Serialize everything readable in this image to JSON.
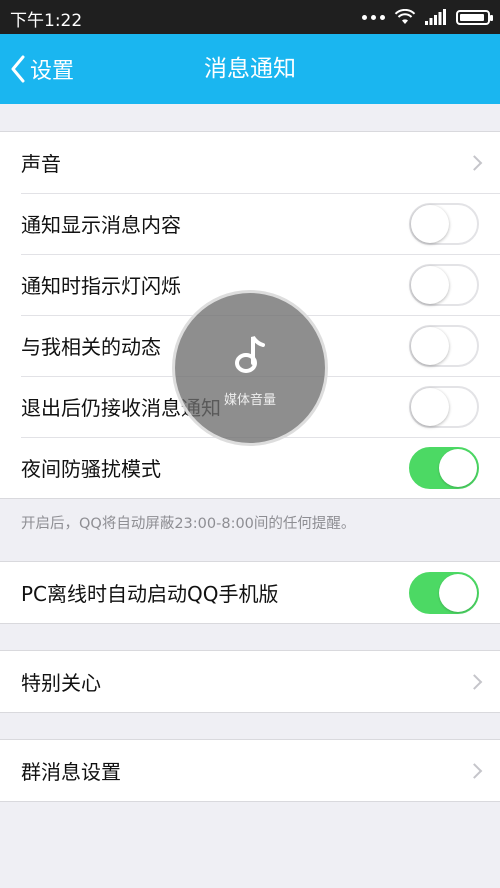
{
  "status_bar": {
    "time": "下午1:22"
  },
  "nav": {
    "back_label": "设置",
    "title": "消息通知"
  },
  "rows": {
    "sound": "声音",
    "show_content": {
      "label": "通知显示消息内容",
      "on": false
    },
    "indicator_light": {
      "label": "通知时指示灯闪烁",
      "on": false
    },
    "related_updates": {
      "label": "与我相关的动态",
      "on": false
    },
    "receive_after_exit": {
      "label": "退出后仍接收消息通知",
      "on": false
    },
    "night_mode": {
      "label": "夜间防骚扰模式",
      "on": true
    },
    "night_hint": "开启后，QQ将自动屏蔽23:00-8:00间的任何提醒。",
    "pc_offline": {
      "label": "PC离线时自动启动QQ手机版",
      "on": true
    },
    "special_care": "特别关心",
    "group_settings": "群消息设置"
  },
  "volume_overlay": {
    "label": "媒体音量",
    "icon": "music-note-icon"
  },
  "colors": {
    "nav": "#1ab6f0",
    "toggle_on": "#4cd964",
    "statusbar": "#1f1f1f"
  }
}
